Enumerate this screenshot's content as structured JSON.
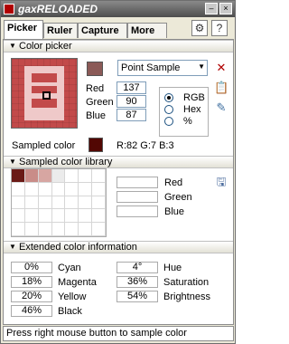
{
  "window": {
    "title": "gaxRELOADED",
    "min_label": "–",
    "close_label": "×"
  },
  "tabs": [
    {
      "label": "Picker",
      "active": true
    },
    {
      "label": "Ruler",
      "active": false
    },
    {
      "label": "Capture",
      "active": false
    },
    {
      "label": "More",
      "active": false
    }
  ],
  "picker": {
    "section_label": "Color picker",
    "mode_select": "Point Sample",
    "red_label": "Red",
    "red_value": "137",
    "green_label": "Green",
    "green_value": "90",
    "blue_label": "Blue",
    "blue_value": "87",
    "modes": [
      {
        "label": "RGB",
        "selected": true
      },
      {
        "label": "Hex",
        "selected": false
      },
      {
        "label": "%",
        "selected": false
      }
    ],
    "sampled_label": "Sampled color",
    "sampled_value": "R:82 G:7 B:3",
    "current_swatch": "#8b5a57",
    "sampled_swatch": "#520703"
  },
  "library": {
    "section_label": "Sampled color library",
    "swatches": [
      "#6a1a16",
      "#c98c88",
      "#d7a6a2",
      "#ebebeb"
    ],
    "red_label": "Red",
    "green_label": "Green",
    "blue_label": "Blue"
  },
  "extended": {
    "section_label": "Extended color information",
    "cyan_value": "0%",
    "cyan_label": "Cyan",
    "magenta_value": "18%",
    "magenta_label": "Magenta",
    "yellow_value": "20%",
    "yellow_label": "Yellow",
    "black_value": "46%",
    "black_label": "Black",
    "hue_value": "4°",
    "hue_label": "Hue",
    "saturation_value": "36%",
    "saturation_label": "Saturation",
    "brightness_value": "54%",
    "brightness_label": "Brightness"
  },
  "status": {
    "text": "Press right mouse button to sample color"
  }
}
